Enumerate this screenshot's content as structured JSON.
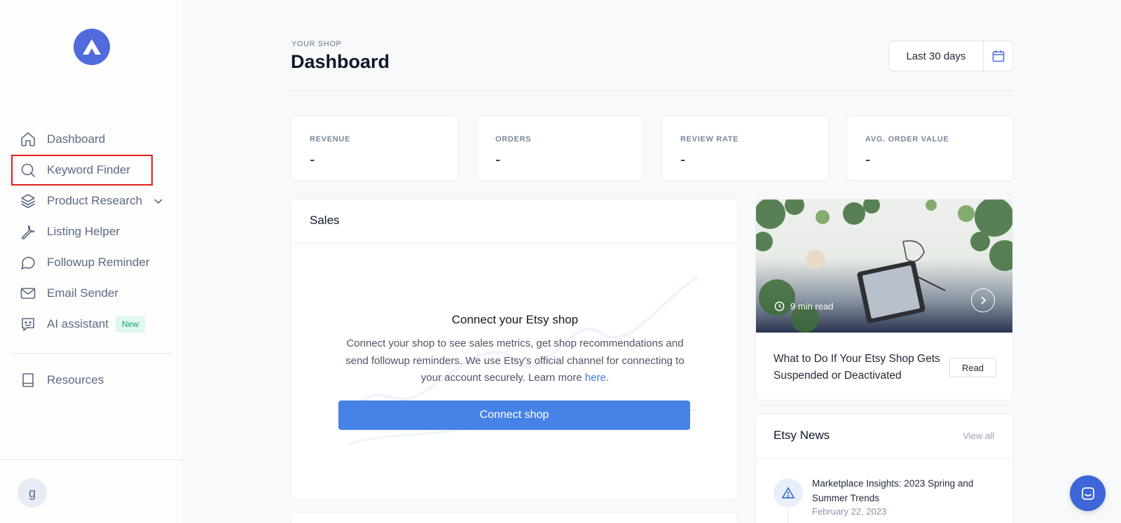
{
  "sidebar": {
    "items": [
      {
        "label": "Dashboard",
        "icon": "home-icon"
      },
      {
        "label": "Keyword Finder",
        "icon": "search-icon"
      },
      {
        "label": "Product Research",
        "icon": "layers-icon"
      },
      {
        "label": "Listing Helper",
        "icon": "wrench-icon"
      },
      {
        "label": "Followup Reminder",
        "icon": "chat-bubble-icon"
      },
      {
        "label": "Email Sender",
        "icon": "mail-icon"
      },
      {
        "label": "AI assistant",
        "icon": "bot-icon",
        "badge": "New"
      }
    ],
    "resources_label": "Resources",
    "avatar_initial": "g"
  },
  "header": {
    "eyebrow": "YOUR SHOP",
    "title": "Dashboard",
    "date_range": "Last 30 days"
  },
  "metrics": [
    {
      "label": "REVENUE",
      "value": "-"
    },
    {
      "label": "ORDERS",
      "value": "-"
    },
    {
      "label": "REVIEW RATE",
      "value": "-"
    },
    {
      "label": "AVG. ORDER VALUE",
      "value": "-"
    }
  ],
  "sales": {
    "title": "Sales",
    "connect_title": "Connect your Etsy shop",
    "connect_desc": "Connect your shop to see sales metrics, get shop recommendations and send followup reminders. We use Etsy's official channel for connecting to your account securely. Learn more ",
    "connect_link": "here",
    "connect_button": "Connect shop"
  },
  "article": {
    "read_time": "9 min read",
    "title": "What to Do If Your Etsy Shop Gets Suspended or Deactivated",
    "read_button": "Read"
  },
  "news": {
    "title": "Etsy News",
    "view_all": "View all",
    "items": [
      {
        "title": "Marketplace Insights: 2023 Spring and Summer Trends",
        "date": "February 22, 2023"
      }
    ]
  },
  "colors": {
    "accent": "#4f6bdc",
    "button": "#4782e6",
    "highlight_border": "#e31d1d",
    "badge_bg": "#dff7ee",
    "badge_text": "#1ba672"
  }
}
